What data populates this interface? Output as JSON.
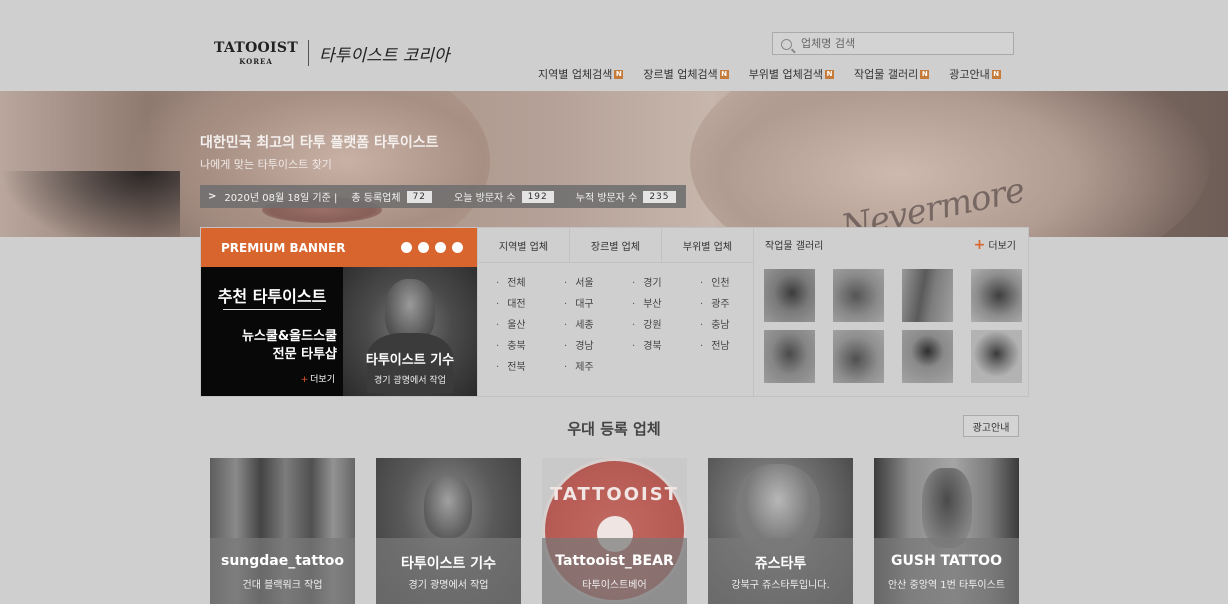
{
  "header": {
    "logo_en": "TATOOIST",
    "logo_en_sub": "KOREA",
    "logo_kr": "타투이스트 코리아",
    "search_placeholder": "업체명 검색",
    "nav": [
      {
        "label": "지역별 업체검색",
        "badge": "N"
      },
      {
        "label": "장르별 업체검색",
        "badge": "N"
      },
      {
        "label": "부위별 업체검색",
        "badge": "N"
      },
      {
        "label": "작업물 갤러리",
        "badge": "N"
      },
      {
        "label": "광고안내",
        "badge": "N"
      }
    ]
  },
  "hero": {
    "title": "대한민국 최고의 타투 플랫폼 타투이스트",
    "subtitle": "나에게 맞는 타투이스트 찾기",
    "tattoo_text": "Nevermore",
    "stats": {
      "chevron": ">",
      "date": "2020년 08월 18일 기준 |",
      "registered_label": "총 등록업체",
      "registered_count": "72",
      "today_label": "오늘 방문자 수",
      "today_count": "192",
      "total_label": "누적 방문자 수",
      "total_count": "235"
    }
  },
  "premium": {
    "title": "PREMIUM BANNER",
    "banner_title": "추천 타투이스트",
    "banner_desc1": "뉴스쿨&올드스쿨",
    "banner_desc2": "전문 타투샵",
    "more_plus": "+",
    "more": "더보기",
    "artist_name": "타투이스트 기수",
    "artist_desc": "경기 광명에서 작업"
  },
  "category": {
    "tabs": [
      "지역별 업체",
      "장르별 업체",
      "부위별 업체"
    ],
    "regions": [
      "전체",
      "서울",
      "경기",
      "인천",
      "대전",
      "대구",
      "부산",
      "광주",
      "울산",
      "세종",
      "강원",
      "충남",
      "충북",
      "경남",
      "경북",
      "전남",
      "전북",
      "제주"
    ]
  },
  "gallery": {
    "title": "작업물 갤러리",
    "more_plus": "+",
    "more": "더보기"
  },
  "registered": {
    "title": "우대 등록 업체",
    "ad_button": "광고안내",
    "cards": [
      {
        "name": "sungdae_tattoo",
        "desc": "건대 블랙워크 작업"
      },
      {
        "name": "타투이스트 기수",
        "desc": "경기 광명에서 작업"
      },
      {
        "name": "Tattooist_BEAR",
        "desc": "타투이스트베어",
        "logo_text": "TATTOOIST"
      },
      {
        "name": "쥬스타투",
        "desc": "강북구 쥬스타투입니다."
      },
      {
        "name": "GUSH TATTOO",
        "desc": "안산 중앙역 1번 타투이스트"
      }
    ]
  },
  "colors": {
    "accent": "#d9652e",
    "background": "#cfcfcf",
    "badge": "#c77b3a"
  }
}
